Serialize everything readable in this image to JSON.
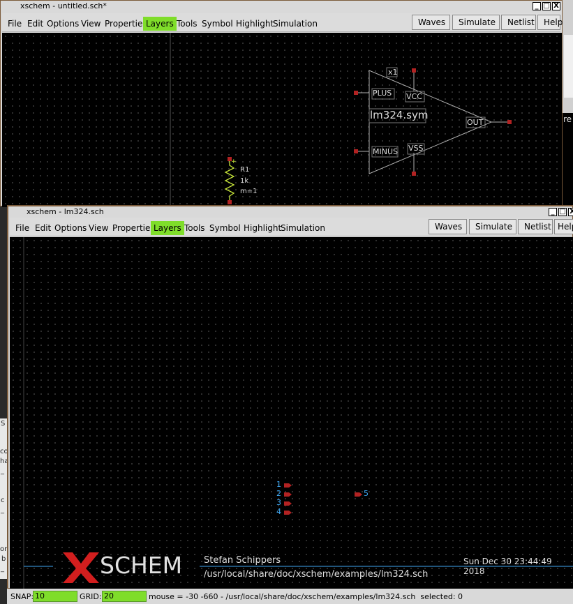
{
  "colors": {
    "layers_active": "#7fdd2a",
    "canvas_bg": "#000000",
    "wire": "#b0b0b0",
    "pin": "#b22222",
    "net_label": "#3fa9f5",
    "resistor": "#c8e63a"
  },
  "back_window": {
    "title": "xschem - untitled.sch*",
    "menu": [
      "File",
      "Edit",
      "Options",
      "View",
      "Properties",
      "Layers",
      "Tools",
      "Symbol",
      "Highlight",
      "Simulation"
    ],
    "buttons": [
      "Waves",
      "Simulate",
      "Netlist",
      "Help"
    ],
    "window_controls": [
      "_",
      "□",
      "X"
    ],
    "symbol": {
      "instance": "x1",
      "name": "lm324.sym",
      "pins": [
        "PLUS",
        "VCC",
        "MINUS",
        "VSS",
        "OUT"
      ]
    },
    "resistor": {
      "name": "R1",
      "value": "1k",
      "mult": "m=1",
      "plus": "+"
    }
  },
  "side_text": {
    "right_fragment": "re"
  },
  "front_window": {
    "title": "xschem - lm324.sch",
    "menu": [
      "File",
      "Edit",
      "Options",
      "View",
      "Properties",
      "Layers",
      "Tools",
      "Symbol",
      "Highlight",
      "Simulation"
    ],
    "buttons": [
      "Waves",
      "Simulate",
      "Netlist",
      "Help"
    ],
    "window_controls": [
      "_",
      "□",
      "X"
    ],
    "pins_in": [
      "1",
      "2",
      "3",
      "4"
    ],
    "pin_out": "5",
    "title_block": {
      "logo_x": "X",
      "logo_rest": "SCHEM",
      "author": "Stefan Schippers",
      "date": "Sun Dec 30 23:44:49 2018",
      "path": "/usr/local/share/doc/xschem/examples/lm324.sch"
    }
  },
  "status": {
    "snap_label": "SNAP:",
    "snap_value": "10",
    "grid_label": "GRID:",
    "grid_value": "20",
    "info": "mouse = -30 -660 - /usr/local/share/doc/xschem/examples/lm324.sch  selected: 0"
  },
  "background_fragments": [
    "S",
    "co",
    "ha",
    "_",
    "c",
    "_",
    "or",
    "b",
    "_"
  ]
}
